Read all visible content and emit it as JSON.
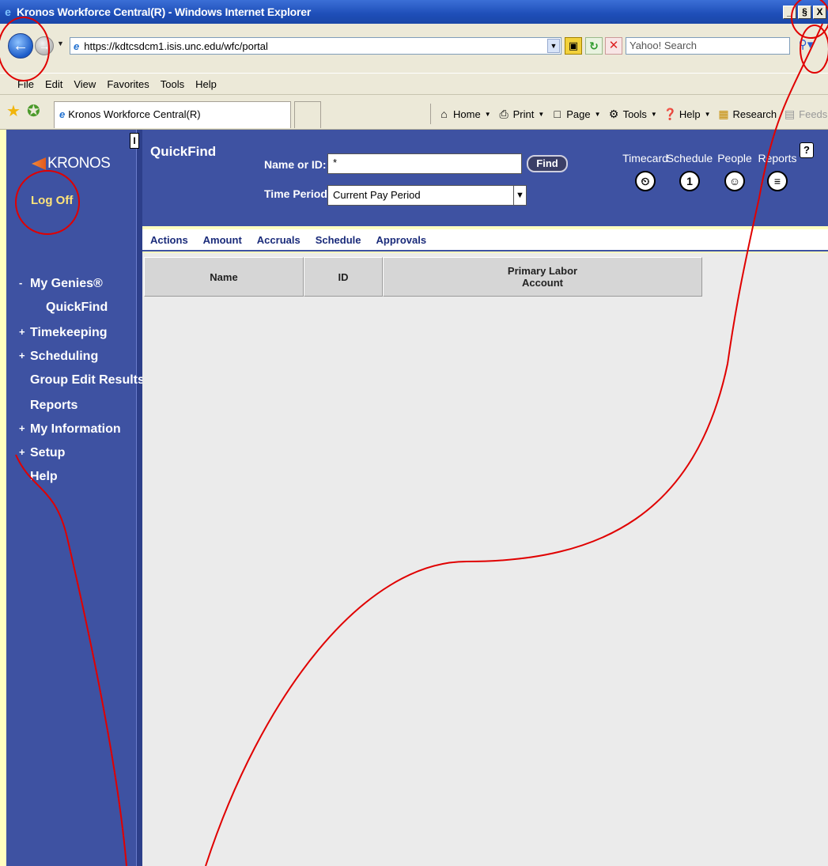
{
  "window": {
    "title": "Kronos Workforce Central(R) - Windows Internet Explorer",
    "minimize": "_",
    "restore": "§",
    "close": "X"
  },
  "address": {
    "url": "https://kdtcsdcm1.isis.unc.edu/wfc/portal",
    "search_placeholder": "Yahoo! Search"
  },
  "menu": [
    "File",
    "Edit",
    "View",
    "Favorites",
    "Tools",
    "Help"
  ],
  "tab": {
    "label": "Kronos Workforce Central(R)"
  },
  "commands": {
    "home": "Home",
    "print": "Print",
    "page": "Page",
    "tools": "Tools",
    "help": "Help",
    "research": "Research",
    "feeds": "Feeds (J)"
  },
  "sidebar": {
    "logo": "KRONOS",
    "logoff": "Log Off",
    "toggle": "I",
    "items": [
      {
        "bullet": "-",
        "label": "My Genies®"
      },
      {
        "bullet": "",
        "label": "QuickFind"
      },
      {
        "bullet": "+",
        "label": "Timekeeping"
      },
      {
        "bullet": "+",
        "label": "Scheduling"
      },
      {
        "bullet": "",
        "label": "Group Edit Results"
      },
      {
        "bullet": "",
        "label": "Reports"
      },
      {
        "bullet": "+",
        "label": "My Information"
      },
      {
        "bullet": "+",
        "label": "Setup"
      },
      {
        "bullet": "",
        "label": "Help"
      }
    ]
  },
  "quickfind": {
    "title": "QuickFind",
    "name_label": "Name or ID:",
    "name_value": "*",
    "find_label": "Find",
    "time_label": "Time Period:",
    "time_value": "Current Pay Period",
    "help": "?"
  },
  "shortcuts": [
    {
      "label": "Timecard",
      "glyph": "⏲"
    },
    {
      "label": "Schedule",
      "glyph": "1"
    },
    {
      "label": "People",
      "glyph": "☺"
    },
    {
      "label": "Reports",
      "glyph": "≡"
    }
  ],
  "app_menu": [
    "Actions",
    "Amount",
    "Accruals",
    "Schedule",
    "Approvals"
  ],
  "grid": {
    "columns": [
      "Name",
      "ID",
      "Primary Labor Account"
    ],
    "col1_line1": "Primary Labor",
    "col1_line2": "Account"
  },
  "colors": {
    "kronos_blue": "#3e52a2",
    "annotation_red": "#e00000",
    "logoff_yellow": "#ffe47a"
  }
}
